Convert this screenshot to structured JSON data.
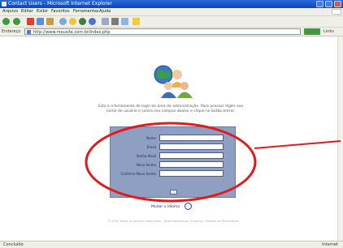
{
  "window": {
    "title": "Contact Users - Microsoft Internet Explorer",
    "buttons": [
      "minimize",
      "maximize",
      "close"
    ]
  },
  "menubar": {
    "items": [
      "Arquivo",
      "Editar",
      "Exibir",
      "Favoritos",
      "Ferramentas",
      "Ajuda"
    ]
  },
  "toolbar": {
    "icons": [
      "back-icon",
      "forward-icon",
      "stop-icon",
      "refresh-icon",
      "home-icon",
      "search-icon",
      "favorites-icon",
      "media-icon",
      "history-icon",
      "mail-icon",
      "print-icon",
      "edit-icon",
      "folder-icon"
    ]
  },
  "addressbar": {
    "label": "Endereço",
    "url": "http://www.meusite.com.br/index.php",
    "go_label": "Ir",
    "links_label": "Links"
  },
  "page": {
    "intro": "Esta é a ferramenta de login do área de administração. Para acessar digite seu nome de usuário e senha nos campos abaixo e clique no botão entrar.",
    "form": {
      "fields": [
        {
          "label": "Nome",
          "value": ""
        },
        {
          "label": "Email",
          "value": ""
        },
        {
          "label": "Senha Atual",
          "value": ""
        },
        {
          "label": "Nova Senha",
          "value": ""
        },
        {
          "label": "Confirme Nova Senha",
          "value": ""
        }
      ],
      "submit_label": "OK"
    },
    "language_link": "Mudar o idioma",
    "footer": "© 2004 Todos os direitos reservados · Desenvolvido por Empresa · Política de Privacidade"
  },
  "statusbar": {
    "left": "Concluído",
    "right": "Internet"
  },
  "colors": {
    "titlebar": "#0b45b7",
    "panel": "#8e9fc2",
    "annotation": "#e11b1b"
  }
}
